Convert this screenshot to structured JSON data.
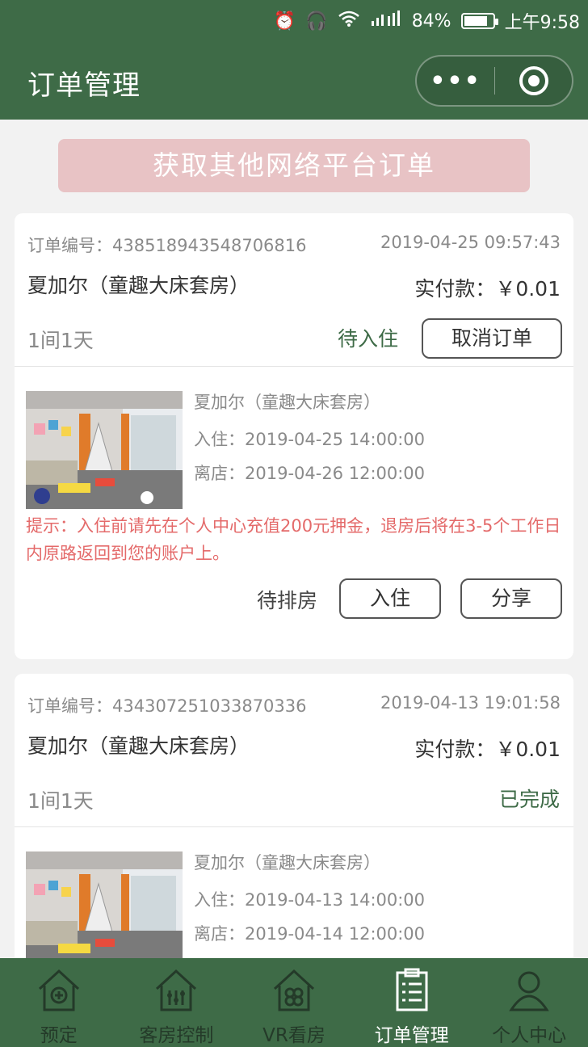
{
  "status_bar": {
    "battery": "84%",
    "time": "上午9:58",
    "battery_level": 0.84
  },
  "nav": {
    "title": "订单管理",
    "more_icon": "more-dots-icon",
    "close_icon": "target-icon"
  },
  "fetch_button": "获取其他网络平台订单",
  "orders": [
    {
      "order_no": "订单编号：438518943548706816",
      "time": "2019-04-25 09:57:43",
      "hotel": "夏加尔（童趣大床套房）",
      "paid": "实付款：￥0.01",
      "nights": "1间1天",
      "status": "待入住",
      "cancel": "取消订单",
      "room_name": "夏加尔（童趣大床套房）",
      "checkin": "入住：2019-04-25 14:00:00",
      "checkout": "离店：2019-04-26 12:00:00",
      "tip": "提示：入住前请先在个人中心充值200元押金，退房后将在3-5个工作日内原路返回到您的账户上。",
      "room_status": "待排房",
      "checkin_btn": "入住",
      "share_btn": "分享"
    },
    {
      "order_no": "订单编号：434307251033870336",
      "time": "2019-04-13 19:01:58",
      "hotel": "夏加尔（童趣大床套房）",
      "paid": "实付款：￥0.01",
      "nights": "1间1天",
      "status": "已完成",
      "room_name": "夏加尔（童趣大床套房）",
      "checkin": "入住：2019-04-13 14:00:00",
      "checkout": "离店：2019-04-14 12:00:00"
    }
  ],
  "tabs": [
    {
      "label": "预定",
      "icon": "house-plus-icon"
    },
    {
      "label": "客房控制",
      "icon": "house-controls-icon"
    },
    {
      "label": "VR看房",
      "icon": "house-vr-icon"
    },
    {
      "label": "订单管理",
      "icon": "clipboard-icon",
      "active": true
    },
    {
      "label": "个人中心",
      "icon": "person-icon"
    }
  ],
  "colors": {
    "brand": "#3e6b47",
    "tip": "#e46a6a",
    "fetch_bg": "#e8c3c5"
  }
}
